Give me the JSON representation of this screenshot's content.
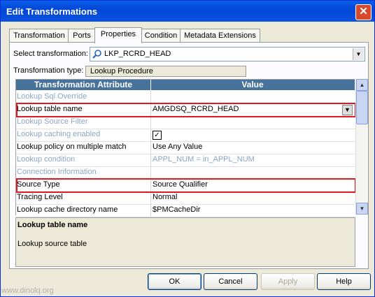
{
  "window": {
    "title": "Edit Transformations",
    "close_glyph": "✕"
  },
  "tabs": [
    {
      "label": "Transformation"
    },
    {
      "label": "Ports"
    },
    {
      "label": "Properties"
    },
    {
      "label": "Condition"
    },
    {
      "label": "Metadata Extensions"
    }
  ],
  "select": {
    "label": "Select transformation:",
    "value": "LKP_RCRD_HEAD",
    "icon": "lookup-icon"
  },
  "trans_type": {
    "label": "Transformation type:",
    "value": "Lookup Procedure"
  },
  "grid": {
    "header": {
      "attribute": "Transformation Attribute",
      "value": "Value"
    },
    "rows": [
      {
        "attr": "Lookup Sql Override",
        "value": ""
      },
      {
        "attr": "Lookup table name",
        "value": "AMGDSQ_RCRD_HEAD"
      },
      {
        "attr": "Lookup Source Filter",
        "value": ""
      },
      {
        "attr": "Lookup caching enabled",
        "value": ""
      },
      {
        "attr": "Lookup policy on multiple match",
        "value": "Use Any Value"
      },
      {
        "attr": "Lookup condition",
        "value": "APPL_NUM = in_APPL_NUM"
      },
      {
        "attr": "Connection Information",
        "value": ""
      },
      {
        "attr": "Source Type",
        "value": "Source Qualifier"
      },
      {
        "attr": "Tracing Level",
        "value": "Normal"
      },
      {
        "attr": "Lookup cache directory name",
        "value": "$PMCacheDir"
      }
    ]
  },
  "description": {
    "title": "Lookup table name",
    "text": "Lookup source table"
  },
  "buttons": {
    "ok": "OK",
    "cancel": "Cancel",
    "apply": "Apply",
    "help": "Help"
  },
  "watermark": "www.dinolq.org",
  "colors": {
    "title_bar": "#0a5fe8",
    "grid_header": "#46729c",
    "highlight": "#e01822",
    "disabled_text": "#8aa6c8"
  }
}
